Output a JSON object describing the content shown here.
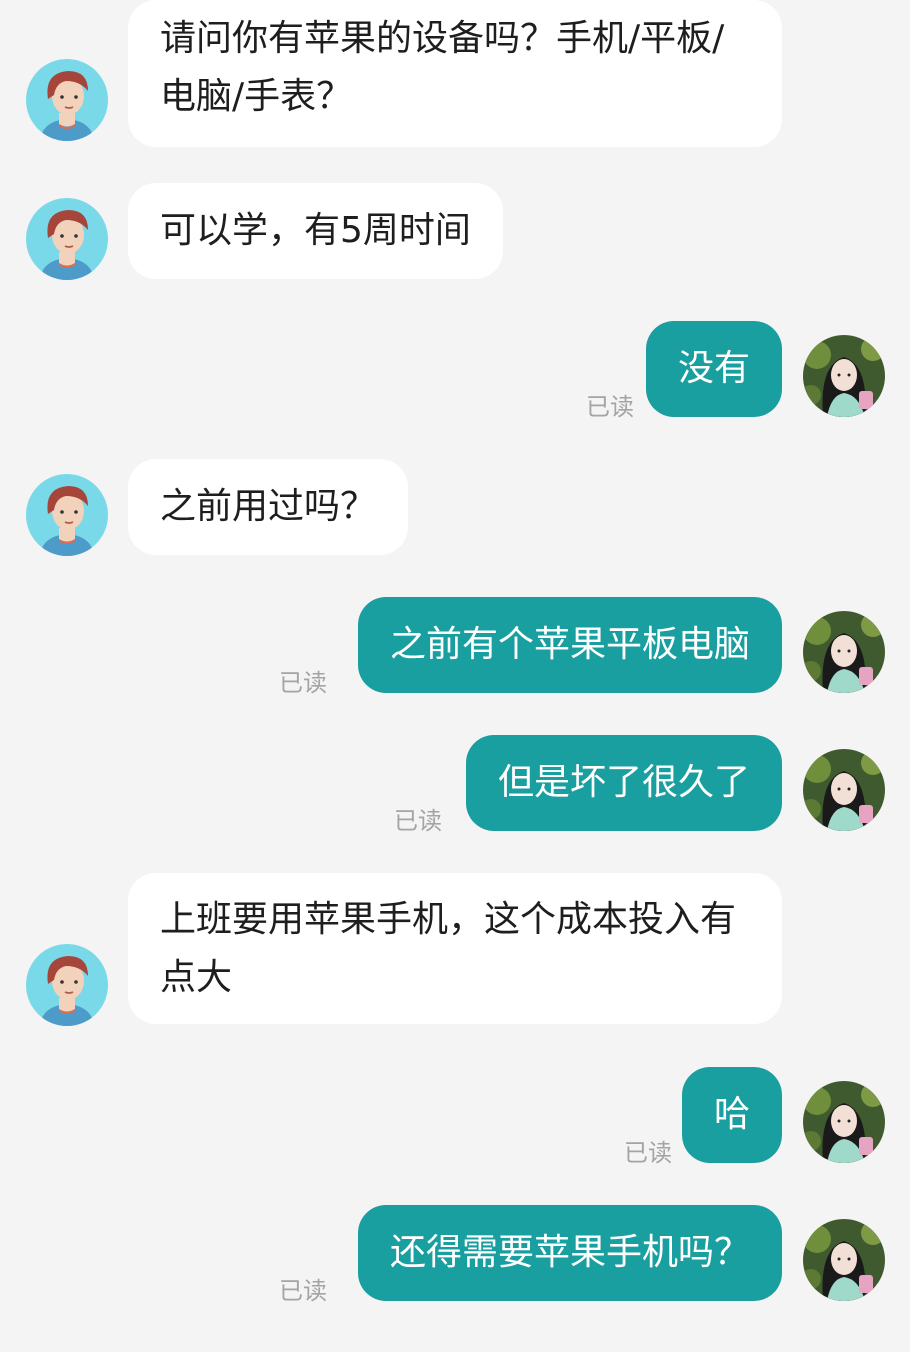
{
  "messages": [
    {
      "side": "in",
      "text": "请问你有苹果的设备吗？手机/平板/电脑/手表？"
    },
    {
      "side": "in",
      "text": "可以学，有5周时间"
    },
    {
      "side": "out",
      "text": "没有",
      "status": "已读"
    },
    {
      "side": "in",
      "text": "之前用过吗？"
    },
    {
      "side": "out",
      "text": "之前有个苹果平板电脑",
      "status": "已读"
    },
    {
      "side": "out",
      "text": "但是坏了很久了",
      "status": "已读"
    },
    {
      "side": "in",
      "text": "上班要用苹果手机，这个成本投入有点大"
    },
    {
      "side": "out",
      "text": "哈",
      "status": "已读"
    },
    {
      "side": "out",
      "text": "还得需要苹果手机吗？",
      "status": "已读"
    }
  ],
  "avatars": {
    "contact": "cartoon-person-avatar",
    "self": "photo-avatar"
  },
  "colors": {
    "background": "#f4f4f4",
    "incoming_bubble": "#ffffff",
    "outgoing_bubble": "#1a9fa1",
    "read_status": "#a4a4a4"
  }
}
